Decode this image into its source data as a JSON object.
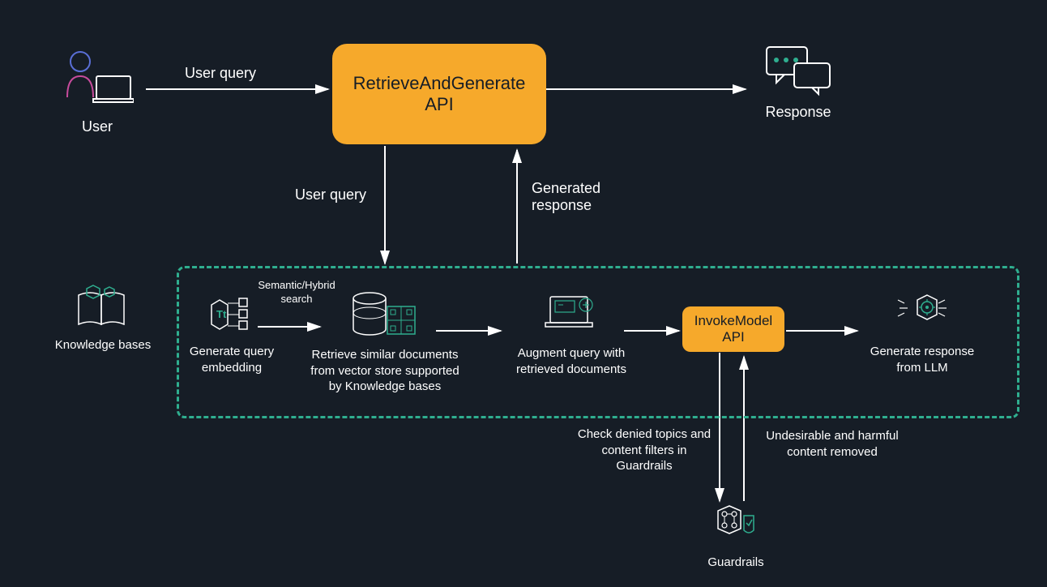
{
  "nodes": {
    "user": "User",
    "retrieve_api": "RetrieveAndGenerate\nAPI",
    "response": "Response",
    "knowledge_bases": "Knowledge bases",
    "gen_embedding": "Generate query\nembedding",
    "semantic_search": "Semantic/Hybrid\nsearch",
    "retrieve_docs": "Retrieve similar documents\nfrom vector store supported\nby Knowledge bases",
    "augment": "Augment query with\nretrieved documents",
    "invoke_api": "InvokeModel\nAPI",
    "gen_response": "Generate response\nfrom LLM",
    "guardrails": "Guardrails"
  },
  "arrows": {
    "user_query_top": "User query",
    "user_query_down": "User query",
    "generated_response": "Generated\nresponse",
    "check_denied": "Check denied topics and\ncontent filters in\nGuardrails",
    "undesirable": "Undesirable and harmful\ncontent removed"
  },
  "colors": {
    "bg": "#161d26",
    "orange": "#f6a92b",
    "teal": "#2fae8f",
    "white": "#ffffff"
  }
}
